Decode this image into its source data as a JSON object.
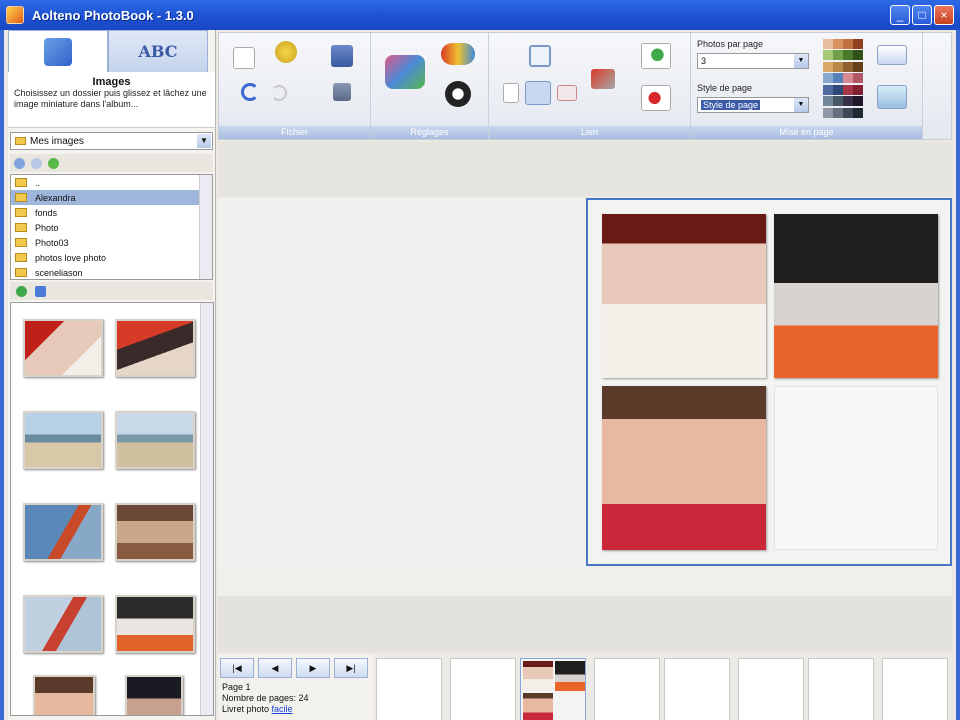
{
  "window": {
    "title": "Aolteno PhotoBook - 1.3.0",
    "controls": [
      "_",
      "□",
      "×"
    ]
  },
  "left_panel": {
    "tabs": [
      {
        "name": "images-tab",
        "icon": "images-icon"
      },
      {
        "name": "text-tab",
        "icon_text": "ABC"
      }
    ],
    "section_title": "Images",
    "section_desc": "Choisissez un dossier puis glissez et lâchez une image miniature dans l'album...",
    "folder_combo": "Mes images",
    "folders": [
      "..",
      "Alexandra",
      "fonds",
      "Photo",
      "Photo03",
      "photos love photo",
      "sceneliason"
    ],
    "selected_folder": "Alexandra"
  },
  "ribbon": {
    "groups": [
      {
        "label": "Fichier"
      },
      {
        "label": "Réglages"
      },
      {
        "label": "Lien"
      },
      {
        "label": "Mise en page"
      }
    ],
    "photos_per_page_label": "Photos par page",
    "photos_per_page_value": "3",
    "page_style_label": "Style de page",
    "page_style_value": "Style de page"
  },
  "status": {
    "page": "Page 1",
    "page_count": "Nombre de pages: 24",
    "photo_label": "Livret photo",
    "photo_link": "facile"
  },
  "nav_buttons": [
    "|◀",
    "◀",
    "▶",
    "▶|"
  ],
  "colors": {
    "title_bar": "#1b50d0",
    "selection": "#9fb6dc",
    "page_border": "#4a76c8"
  }
}
